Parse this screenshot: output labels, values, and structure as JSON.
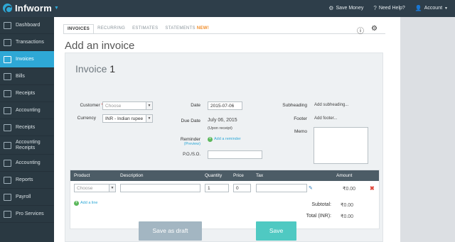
{
  "app": {
    "name": "Infworm"
  },
  "top_links": {
    "save_money": "Save Money",
    "help": "Need Help?",
    "account": "Account"
  },
  "sidebar": {
    "items": [
      {
        "label": "Dashboard",
        "icon": "dashboard-icon"
      },
      {
        "label": "Transactions",
        "icon": "transactions-icon"
      },
      {
        "label": "Invoices",
        "icon": "invoices-icon",
        "active": true
      },
      {
        "label": "Bills",
        "icon": "bills-icon"
      },
      {
        "label": "Receipts",
        "icon": "receipts-icon"
      },
      {
        "label": "Accounting",
        "icon": "accounting-icon"
      },
      {
        "label": "Receipts",
        "icon": "receipts-icon"
      },
      {
        "label": "Accounting",
        "label2": "Receipts",
        "icon": "accounting-icon"
      },
      {
        "label": "Accounting",
        "icon": "accounting-icon"
      },
      {
        "label": "Reports",
        "icon": "reports-icon"
      },
      {
        "label": "Payroll",
        "icon": "payroll-icon"
      },
      {
        "label": "Pro Services",
        "icon": "pro-services-icon"
      }
    ]
  },
  "tabs": [
    {
      "label": "INVOICES",
      "active": true
    },
    {
      "label": "RECURRING"
    },
    {
      "label": "ESTIMATES"
    },
    {
      "label": "STATEMENTS",
      "badge": "NEW!"
    }
  ],
  "page_title": "Add an invoice",
  "invoice": {
    "title_prefix": "Invoice",
    "number": "1",
    "customer_label": "Customer",
    "customer_required": "*",
    "customer_placeholder": "Choose",
    "currency_label": "Currency",
    "currency_value": "INR - Indian rupee",
    "date_label": "Date",
    "date_value": "2015-07-06",
    "due_label": "Due Date",
    "due_value": "July 06, 2015",
    "due_note": "(Upon receipt)",
    "reminder_label": "Reminder",
    "reminder_preview": "(Preview)",
    "add_reminder": "Add a reminder",
    "po_label": "P.O./S.O.",
    "subheading_label": "Subheading",
    "subheading_placeholder": "Add subheading...",
    "footer_label": "Footer",
    "footer_placeholder": "Add footer...",
    "memo_label": "Memo"
  },
  "table": {
    "headers": {
      "product": "Product",
      "description": "Description",
      "quantity": "Quantity",
      "price": "Price",
      "tax": "Tax",
      "amount": "Amount"
    },
    "row": {
      "product_placeholder": "Choose",
      "quantity": "1",
      "price": "0",
      "amount": "₹0.00"
    },
    "add_line": "Add a line",
    "subtotal_label": "Subtotal:",
    "subtotal_value": "₹0.00",
    "total_label": "Total (INR):",
    "total_value": "₹0.00"
  },
  "buttons": {
    "draft": "Save as draft",
    "save": "Save"
  },
  "colors": {
    "accent": "#2ea8d6",
    "topbar": "#2e3e4a",
    "sidebar": "#2a3942",
    "save": "#4fc9c2",
    "draft": "#a3b6c2"
  }
}
